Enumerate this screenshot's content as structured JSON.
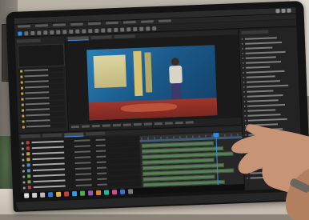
{
  "app": {
    "accent_color": "#2e8fe0",
    "panels": {
      "project": {
        "title": ""
      },
      "viewer": {
        "title": ""
      },
      "effects": {
        "title": ""
      },
      "timeline": {
        "title": ""
      }
    }
  },
  "icons": {
    "window_controls": [
      "minimize-icon",
      "maximize-icon",
      "close-icon"
    ],
    "taskbar": [
      "windows-start-icon",
      "search-icon",
      "task-view-icon",
      "app-icon",
      "app-icon",
      "app-icon",
      "app-icon",
      "app-icon",
      "app-icon",
      "app-icon",
      "app-icon",
      "app-icon",
      "app-icon",
      "app-icon"
    ]
  },
  "taskbar_colors": [
    "#e0e0e0",
    "#cfcfcf",
    "#bbbbbb",
    "#2b7bd6",
    "#e3b236",
    "#c93c3c",
    "#2e9de0",
    "#4bb04b",
    "#9b59b6",
    "#e67e22",
    "#1abc9c",
    "#d14b8f",
    "#3d6fd1",
    "#7a7a7a"
  ],
  "layer_label_colors": [
    "#c04040",
    "#c04040",
    "#c8a23a",
    "#c8a23a",
    "#4a8fc8",
    "#4a8fc8",
    "#6aa84f",
    "#6aa84f",
    "#c04040"
  ]
}
